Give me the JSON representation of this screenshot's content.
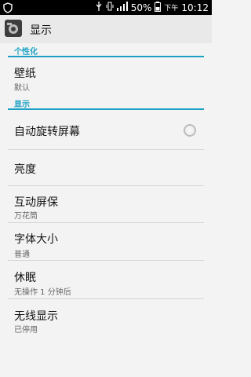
{
  "status_bar": {
    "battery": "50%",
    "ampm": "下午",
    "time": "10:12",
    "icons": [
      "shield-icon",
      "usb-icon",
      "vibrate-icon",
      "signal-icon",
      "battery-icon"
    ]
  },
  "app": {
    "title": "显示",
    "icon": "display-settings-icon"
  },
  "sections": {
    "personal": "个性化",
    "display": "显示"
  },
  "items": {
    "wallpaper": {
      "title": "壁纸",
      "summary": "默认"
    },
    "auto_rotate": {
      "title": "自动旋转屏幕",
      "checked": false
    },
    "brightness": {
      "title": "亮度"
    },
    "daydream": {
      "title": "互动屏保",
      "summary": "万花筒"
    },
    "font_size": {
      "title": "字体大小",
      "summary": "普通"
    },
    "sleep": {
      "title": "休眠",
      "summary": "无操作 1 分钟后"
    },
    "wireless_display": {
      "title": "无线显示",
      "summary": "已停用"
    }
  },
  "colors": {
    "accent": "#1aa1c5",
    "statusbar": "#000000",
    "background": "#f3f3f3"
  }
}
